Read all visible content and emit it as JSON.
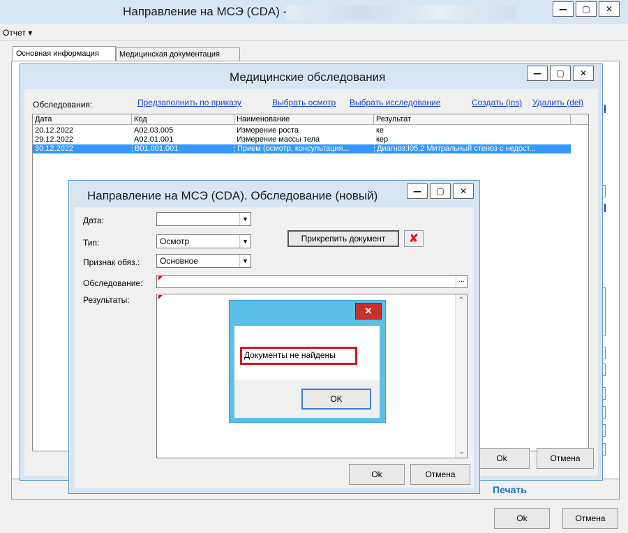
{
  "main_window": {
    "title": "Направление на МСЭ (CDA) -",
    "menu_report": "Отчет ▾",
    "tabs": [
      "Основная информация",
      "Медицинская документация"
    ],
    "print_label": "Печать",
    "ok_label": "Ok",
    "cancel_label": "Отмена"
  },
  "exams_window": {
    "title": "Медицинские обследования",
    "exams_label": "Обследования:",
    "links": {
      "prefill": "Предзаполнить по приказу",
      "choose_exam": "Выбрать осмотр",
      "choose_study": "Выбрать исследование",
      "create": "Создать (ins)",
      "delete": "Удалить (del)"
    },
    "columns": [
      "Дата",
      "Код",
      "Наименование",
      "Результат"
    ],
    "rows": [
      {
        "date": "20.12.2022",
        "code": "A02.03.005",
        "name": "Измерение роста",
        "result": "ке"
      },
      {
        "date": "29.12.2022",
        "code": "A02.01.001",
        "name": "Измерение массы тела",
        "result": "кер"
      },
      {
        "date": "30.12.2022",
        "code": "B01.001.001",
        "name": "Прием (осмотр, консультация...",
        "result": "Диагноз:I05.2 Митральный стеноз с недост..."
      }
    ],
    "selected_row": 2,
    "ok_label": "Ok",
    "cancel_label": "Отмена"
  },
  "new_exam_window": {
    "title": "Направление на МСЭ (CDA). Обследование (новый)",
    "date_label": "Дата:",
    "date_value": "",
    "type_label": "Тип:",
    "type_value": "Осмотр",
    "required_label": "Признак обяз.:",
    "required_value": "Основное",
    "exam_label": "Обследование:",
    "results_label": "Результаты:",
    "attach_label": "Прикрепить документ",
    "ok_label": "Ok",
    "cancel_label": "Отмена"
  },
  "message_box": {
    "message": "Документы не найдены",
    "ok_label": "OK"
  },
  "colors": {
    "titlebar": "#d7e4f2",
    "selection": "#3399ff",
    "msg_title": "#5bc0e8",
    "close_red": "#c9302c",
    "highlight": "#e0101a",
    "link": "#1a3fd3"
  }
}
